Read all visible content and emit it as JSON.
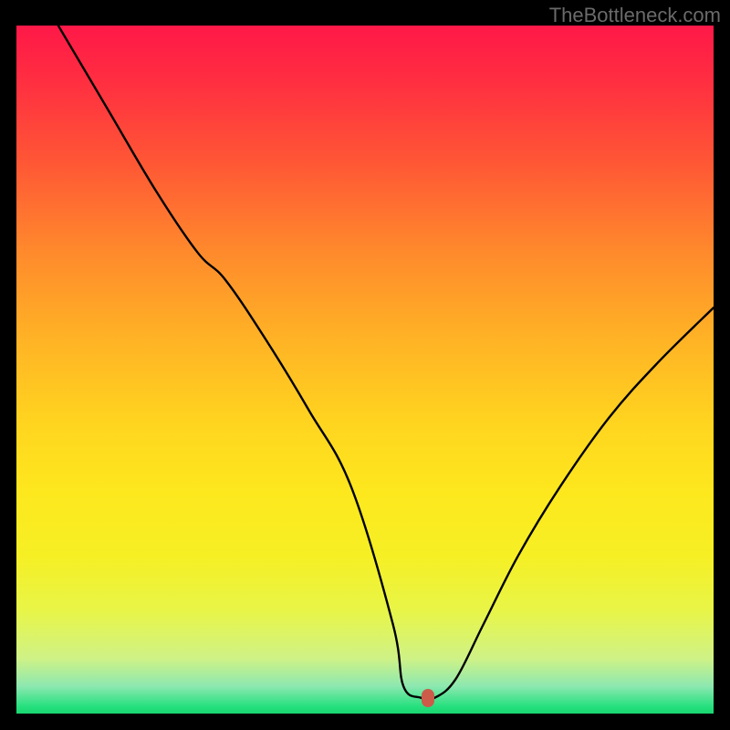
{
  "watermark": "TheBottleneck.com",
  "colors": {
    "frame": "#000000",
    "curve": "#000000",
    "marker": "#cc5b4a"
  },
  "marker": {
    "x_frac": 0.59,
    "y_frac": 0.977
  },
  "chart_data": {
    "type": "line",
    "title": "",
    "xlabel": "",
    "ylabel": "",
    "xlim": [
      0,
      100
    ],
    "ylim": [
      0,
      100
    ],
    "series": [
      {
        "name": "bottleneck-curve",
        "x": [
          6.0,
          13.0,
          20.0,
          26.0,
          30.0,
          36.0,
          42.0,
          48.0,
          54.0,
          55.5,
          58.0,
          60.0,
          63.0,
          67.0,
          72.0,
          78.0,
          85.0,
          92.0,
          100.0
        ],
        "y": [
          100.0,
          88.0,
          76.0,
          67.0,
          63.0,
          54.0,
          44.0,
          33.0,
          13.0,
          4.0,
          2.3,
          2.3,
          5.0,
          13.0,
          23.0,
          33.0,
          43.0,
          51.0,
          59.0
        ]
      }
    ],
    "annotations": [
      {
        "type": "marker",
        "x": 59.0,
        "y": 2.3,
        "label": "optimal-point"
      }
    ],
    "background_gradient_stops": [
      {
        "pct": 0,
        "color": "#ff1848"
      },
      {
        "pct": 20,
        "color": "#ff5735"
      },
      {
        "pct": 46,
        "color": "#ffb425"
      },
      {
        "pct": 68,
        "color": "#fde81e"
      },
      {
        "pct": 92,
        "color": "#cff286"
      },
      {
        "pct": 100,
        "color": "#18d66f"
      }
    ]
  }
}
